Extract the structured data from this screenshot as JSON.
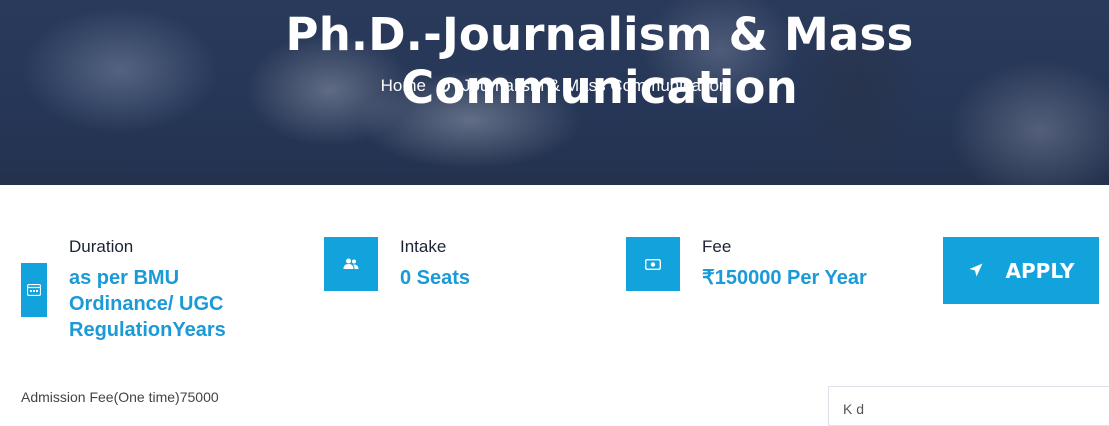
{
  "hero": {
    "title": "Ph.D.-Journalism & Mass Communication",
    "breadcrumb": {
      "home": "Home",
      "current": "Journalism & Mass Communication"
    }
  },
  "info": {
    "duration": {
      "label": "Duration",
      "value": "as per BMU Ordinance/ UGC RegulationYears",
      "icon": "calendar-icon"
    },
    "intake": {
      "label": "Intake",
      "value": "0 Seats",
      "icon": "users-icon"
    },
    "fee": {
      "label": "Fee",
      "value": "₹150000 Per Year",
      "icon": "money-icon"
    }
  },
  "apply": {
    "label": "APPLY",
    "icon": "send-icon"
  },
  "admission_fee": "Admission Fee(One time)75000",
  "sidebar": {
    "partial_text": "K        d"
  },
  "colors": {
    "accent": "#12a3dd",
    "hero_overlay": "#263656",
    "value_text": "#1a9ad6"
  }
}
